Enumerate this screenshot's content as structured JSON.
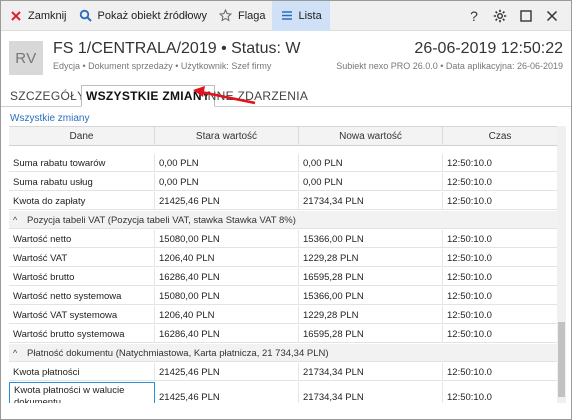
{
  "toolbar": {
    "close_label": "Zamknij",
    "source_label": "Pokaż obiekt źródłowy",
    "flag_label": "Flaga",
    "list_label": "Lista",
    "help_glyph": "?",
    "icons": [
      "close-icon",
      "search-icon",
      "star-icon",
      "list-icon",
      "help-icon",
      "gear-icon",
      "maximize-icon",
      "close-window-icon"
    ]
  },
  "header": {
    "avatar": "RV",
    "title": "FS 1/CENTRALA/2019 • Status: W",
    "meta": "Edycja  •  Dokument sprzedaży  •  Użytkownik: Szef firmy",
    "datetime": "26-06-2019 12:50:22",
    "system": "Subiekt nexo PRO 26.0.0  •  Data aplikacyjna: 26-06-2019"
  },
  "tabs": [
    "SZCZEGÓŁY",
    "WSZYSTKIE ZMIANY",
    "INNE ZDARZENIA"
  ],
  "section_title": "Wszystkie zmiany",
  "grid": {
    "columns": [
      "Dane",
      "Stara wartość",
      "Nowa wartość",
      "Czas"
    ],
    "rows": [
      {
        "type": "data",
        "dane": "Suma rabatu towarów",
        "stara": "0,00 PLN",
        "nowa": "0,00 PLN",
        "czas": "12:50:10.0"
      },
      {
        "type": "data",
        "dane": "Suma rabatu usług",
        "stara": "0,00 PLN",
        "nowa": "0,00 PLN",
        "czas": "12:50:10.0"
      },
      {
        "type": "data",
        "dane": "Kwota do zapłaty",
        "stara": "21425,46 PLN",
        "nowa": "21734,34 PLN",
        "czas": "12:50:10.0"
      },
      {
        "type": "group",
        "label": "Pozycja tabeli VAT (Pozycja tabeli VAT, stawka Stawka VAT 8%)"
      },
      {
        "type": "data",
        "dane": "Wartość netto",
        "stara": "15080,00 PLN",
        "nowa": "15366,00 PLN",
        "czas": "12:50:10.0"
      },
      {
        "type": "data",
        "dane": "Wartość VAT",
        "stara": "1206,40 PLN",
        "nowa": "1229,28 PLN",
        "czas": "12:50:10.0"
      },
      {
        "type": "data",
        "dane": "Wartość brutto",
        "stara": "16286,40 PLN",
        "nowa": "16595,28 PLN",
        "czas": "12:50:10.0"
      },
      {
        "type": "data",
        "dane": "Wartość netto systemowa",
        "stara": "15080,00 PLN",
        "nowa": "15366,00 PLN",
        "czas": "12:50:10.0"
      },
      {
        "type": "data",
        "dane": "Wartość VAT systemowa",
        "stara": "1206,40 PLN",
        "nowa": "1229,28 PLN",
        "czas": "12:50:10.0"
      },
      {
        "type": "data",
        "dane": "Wartość brutto systemowa",
        "stara": "16286,40 PLN",
        "nowa": "16595,28 PLN",
        "czas": "12:50:10.0"
      },
      {
        "type": "group",
        "label": "Płatność dokumentu (Natychmiastowa, Karta płatnicza, 21 734,34 PLN)"
      },
      {
        "type": "data",
        "dane": "Kwota płatności",
        "stara": "21425,46 PLN",
        "nowa": "21734,34 PLN",
        "czas": "12:50:10.0"
      },
      {
        "type": "data",
        "dane": "Kwota płatności w walucie dokumentu",
        "stara": "21425,46 PLN",
        "nowa": "21734,34 PLN",
        "czas": "12:50:10.0"
      }
    ]
  },
  "colors": {
    "accent": "#2a6ebb",
    "selection": "#2a8fd6",
    "arrow": "#e0141e",
    "active_tab_bg": "#cfe0f7",
    "close_icon": "#d9262b"
  }
}
